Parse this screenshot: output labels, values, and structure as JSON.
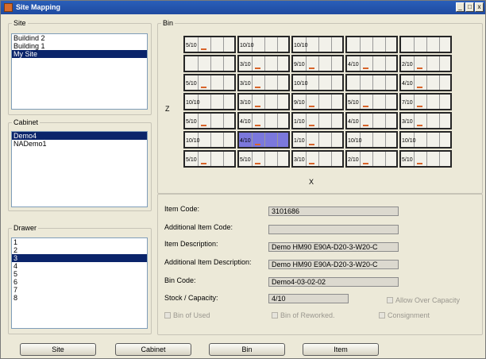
{
  "window": {
    "title": "Site Mapping",
    "controls": [
      "_",
      "□",
      "x"
    ]
  },
  "site": {
    "legend": "Site",
    "items": [
      "Buildind 2",
      "Building 1",
      "My Site"
    ],
    "selected_index": 2
  },
  "cabinet": {
    "legend": "Cabinet",
    "items": [
      "Demo4",
      "NADemo1"
    ],
    "selected_index": 0
  },
  "drawer": {
    "legend": "Drawer",
    "items": [
      "1",
      "2",
      "3",
      "4",
      "5",
      "6",
      "7",
      "8"
    ],
    "selected_index": 2
  },
  "bin": {
    "legend": "Bin",
    "z_label": "Z",
    "x_label": "X",
    "rows": [
      [
        {
          "label": "5/10",
          "flag": true
        },
        {
          "label": "10/10",
          "flag": false
        },
        {
          "label": "10/10",
          "flag": false
        },
        {
          "label": "",
          "flag": false
        },
        {
          "label": "",
          "flag": false
        }
      ],
      [
        {
          "label": "",
          "flag": false
        },
        {
          "label": "3/10",
          "flag": true
        },
        {
          "label": "9/10",
          "flag": true
        },
        {
          "label": "4/10",
          "flag": true
        },
        {
          "label": "2/10",
          "flag": true
        }
      ],
      [
        {
          "label": "5/10",
          "flag": true
        },
        {
          "label": "3/10",
          "flag": true
        },
        {
          "label": "10/10",
          "flag": false
        },
        {
          "label": "",
          "flag": false
        },
        {
          "label": "4/10",
          "flag": true
        }
      ],
      [
        {
          "label": "10/10",
          "flag": false
        },
        {
          "label": "3/10",
          "flag": true
        },
        {
          "label": "9/10",
          "flag": true
        },
        {
          "label": "5/10",
          "flag": true
        },
        {
          "label": "7/10",
          "flag": true
        }
      ],
      [
        {
          "label": "5/10",
          "flag": true
        },
        {
          "label": "4/10",
          "flag": true
        },
        {
          "label": "1/10",
          "flag": true
        },
        {
          "label": "4/10",
          "flag": true
        },
        {
          "label": "3/10",
          "flag": true
        }
      ],
      [
        {
          "label": "10/10",
          "flag": false
        },
        {
          "label": "4/10",
          "flag": true,
          "selected": true
        },
        {
          "label": "1/10",
          "flag": true
        },
        {
          "label": "10/10",
          "flag": false
        },
        {
          "label": "10/10",
          "flag": false
        }
      ],
      [
        {
          "label": "5/10",
          "flag": true
        },
        {
          "label": "5/10",
          "flag": true
        },
        {
          "label": "3/10",
          "flag": true
        },
        {
          "label": "2/10",
          "flag": true
        },
        {
          "label": "5/10",
          "flag": true
        }
      ]
    ]
  },
  "details": {
    "item_code_label": "Item Code:",
    "item_code_value": "3101686",
    "additional_item_code_label": "Additional Item Code:",
    "additional_item_code_value": "",
    "item_description_label": "Item Description:",
    "item_description_value": "Demo HM90 E90A-D20-3-W20-C",
    "additional_item_description_label": "Additional Item Description:",
    "additional_item_description_value": "Demo HM90 E90A-D20-3-W20-C",
    "bin_code_label": "Bin Code:",
    "bin_code_value": "Demo4-03-02-02",
    "stock_capacity_label": "Stock / Capacity:",
    "stock_capacity_value": "4/10",
    "allow_over_capacity_label": "Allow Over Capacity",
    "bin_of_used_label": "Bin of Used",
    "bin_of_reworked_label": "Bin of Reworked.",
    "consignment_label": "Consignment"
  },
  "buttons": {
    "site": "Site",
    "cabinet": "Cabinet",
    "bin": "Bin",
    "item": "Item"
  },
  "colors": {
    "selection": "#0a246a",
    "selected_bin": "#7b78dc",
    "bin_flag": "#d8642a",
    "titlebar": "#2a5fb9"
  }
}
